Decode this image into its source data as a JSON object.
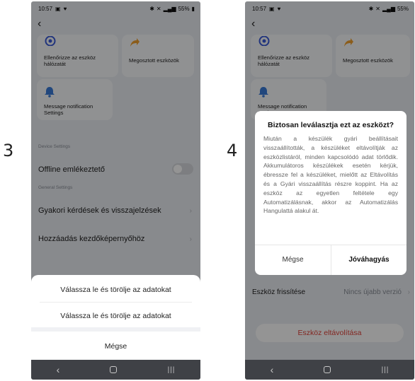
{
  "steps": [
    "3",
    "4"
  ],
  "status_bar": {
    "time": "10:57",
    "battery": "55%"
  },
  "tiles": {
    "network_check": "Ellenőrizze az eszköz hálózatát",
    "shared_devices": "Megosztott eszközök",
    "message_notification": "Message notification Settings"
  },
  "device_settings": {
    "caption": "Device Settings",
    "offline_reminder": "Offline emlékeztető"
  },
  "general_settings": {
    "caption": "General Settings",
    "faq": "Gyakori kérdések és visszajelzések",
    "add_home": "Hozzáadás kezdőképernyőhöz"
  },
  "action_sheet": {
    "option_1": "Válassza le és törölje az adatokat",
    "option_2": "Válassza le és törölje az adatokat",
    "cancel": "Mégse"
  },
  "firmware": {
    "label": "Eszköz frissítése",
    "value": "Nincs újabb verzió"
  },
  "remove_button": "Eszköz eltávolítása",
  "dialog": {
    "title": "Biztosan leválasztja ezt az eszközt?",
    "body": "Miután a készülék gyári beállításait visszaállították, a készüléket eltávolítják az eszközlistáról, minden kapcsolódó adat törlődik. Akkumulátoros készülékek esetén kérjük, ébressze fel a készüléket, mielőtt az Eltávolítás és a Gyári visszaállítás részre koppint. Ha az eszköz az egyetlen feltétele egy Automatizálásnak, akkor az Automatizálás Hangulattá alakul át.",
    "cancel": "Mégse",
    "confirm": "Jóváhagyás"
  },
  "colors": {
    "danger": "#e0433a",
    "network_icon": "#3a5bd8",
    "shared_icon": "#f0a030",
    "bell_icon": "#3a7bd8"
  }
}
